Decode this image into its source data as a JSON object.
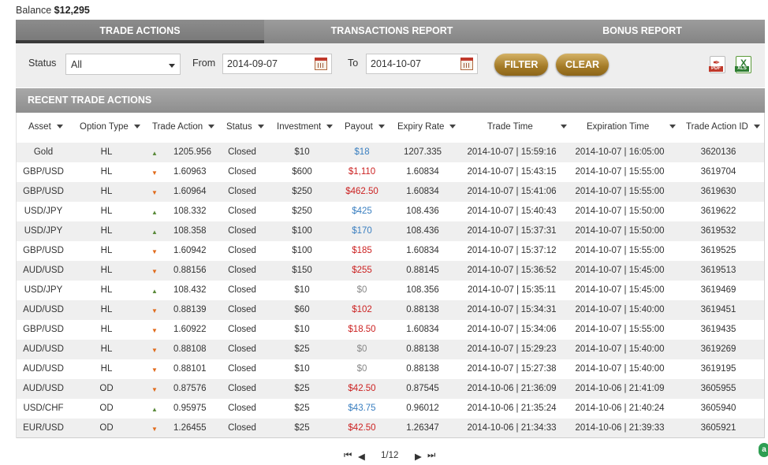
{
  "balance": {
    "label": "Balance",
    "value": "$12,295"
  },
  "tabs": [
    {
      "label": "TRADE ACTIONS"
    },
    {
      "label": "TRANSACTIONS REPORT"
    },
    {
      "label": "BONUS REPORT"
    }
  ],
  "filter": {
    "status_label": "Status",
    "status_value": "All",
    "from_label": "From",
    "from_value": "2014-09-07",
    "to_label": "To",
    "to_value": "2014-10-07",
    "filter_button": "FILTER",
    "clear_button": "CLEAR",
    "pdf_icon": "pdf-export-icon",
    "pdf_tag": "PDF",
    "xls_icon": "xls-export-icon",
    "xls_tag": "XLS"
  },
  "section_title": "RECENT TRADE ACTIONS",
  "columns": [
    "Asset",
    "Option Type",
    "Trade Action",
    "Status",
    "Investment",
    "Payout",
    "Expiry Rate",
    "Trade Time",
    "Expiration Time",
    "Trade Action ID"
  ],
  "rows": [
    {
      "asset": "Gold",
      "type": "HL",
      "dir": "up",
      "action": "1205.956",
      "status": "Closed",
      "investment": "$10",
      "payout": "$18",
      "payout_kind": "win",
      "expiry": "1207.335",
      "trade_time": "2014-10-07 | 15:59:16",
      "exp_time": "2014-10-07 | 16:05:00",
      "id": "3620136"
    },
    {
      "asset": "GBP/USD",
      "type": "HL",
      "dir": "down",
      "action": "1.60963",
      "status": "Closed",
      "investment": "$600",
      "payout": "$1,110",
      "payout_kind": "loss",
      "expiry": "1.60834",
      "trade_time": "2014-10-07 | 15:43:15",
      "exp_time": "2014-10-07 | 15:55:00",
      "id": "3619704"
    },
    {
      "asset": "GBP/USD",
      "type": "HL",
      "dir": "down",
      "action": "1.60964",
      "status": "Closed",
      "investment": "$250",
      "payout": "$462.50",
      "payout_kind": "loss",
      "expiry": "1.60834",
      "trade_time": "2014-10-07 | 15:41:06",
      "exp_time": "2014-10-07 | 15:55:00",
      "id": "3619630"
    },
    {
      "asset": "USD/JPY",
      "type": "HL",
      "dir": "up",
      "action": "108.332",
      "status": "Closed",
      "investment": "$250",
      "payout": "$425",
      "payout_kind": "win",
      "expiry": "108.436",
      "trade_time": "2014-10-07 | 15:40:43",
      "exp_time": "2014-10-07 | 15:50:00",
      "id": "3619622"
    },
    {
      "asset": "USD/JPY",
      "type": "HL",
      "dir": "up",
      "action": "108.358",
      "status": "Closed",
      "investment": "$100",
      "payout": "$170",
      "payout_kind": "win",
      "expiry": "108.436",
      "trade_time": "2014-10-07 | 15:37:31",
      "exp_time": "2014-10-07 | 15:50:00",
      "id": "3619532"
    },
    {
      "asset": "GBP/USD",
      "type": "HL",
      "dir": "down",
      "action": "1.60942",
      "status": "Closed",
      "investment": "$100",
      "payout": "$185",
      "payout_kind": "loss",
      "expiry": "1.60834",
      "trade_time": "2014-10-07 | 15:37:12",
      "exp_time": "2014-10-07 | 15:55:00",
      "id": "3619525"
    },
    {
      "asset": "AUD/USD",
      "type": "HL",
      "dir": "down",
      "action": "0.88156",
      "status": "Closed",
      "investment": "$150",
      "payout": "$255",
      "payout_kind": "loss",
      "expiry": "0.88145",
      "trade_time": "2014-10-07 | 15:36:52",
      "exp_time": "2014-10-07 | 15:45:00",
      "id": "3619513"
    },
    {
      "asset": "USD/JPY",
      "type": "HL",
      "dir": "up",
      "action": "108.432",
      "status": "Closed",
      "investment": "$10",
      "payout": "$0",
      "payout_kind": "zero",
      "expiry": "108.356",
      "trade_time": "2014-10-07 | 15:35:11",
      "exp_time": "2014-10-07 | 15:45:00",
      "id": "3619469"
    },
    {
      "asset": "AUD/USD",
      "type": "HL",
      "dir": "down",
      "action": "0.88139",
      "status": "Closed",
      "investment": "$60",
      "payout": "$102",
      "payout_kind": "loss",
      "expiry": "0.88138",
      "trade_time": "2014-10-07 | 15:34:31",
      "exp_time": "2014-10-07 | 15:40:00",
      "id": "3619451"
    },
    {
      "asset": "GBP/USD",
      "type": "HL",
      "dir": "down",
      "action": "1.60922",
      "status": "Closed",
      "investment": "$10",
      "payout": "$18.50",
      "payout_kind": "loss",
      "expiry": "1.60834",
      "trade_time": "2014-10-07 | 15:34:06",
      "exp_time": "2014-10-07 | 15:55:00",
      "id": "3619435"
    },
    {
      "asset": "AUD/USD",
      "type": "HL",
      "dir": "down",
      "action": "0.88108",
      "status": "Closed",
      "investment": "$25",
      "payout": "$0",
      "payout_kind": "zero",
      "expiry": "0.88138",
      "trade_time": "2014-10-07 | 15:29:23",
      "exp_time": "2014-10-07 | 15:40:00",
      "id": "3619269"
    },
    {
      "asset": "AUD/USD",
      "type": "HL",
      "dir": "down",
      "action": "0.88101",
      "status": "Closed",
      "investment": "$10",
      "payout": "$0",
      "payout_kind": "zero",
      "expiry": "0.88138",
      "trade_time": "2014-10-07 | 15:27:38",
      "exp_time": "2014-10-07 | 15:40:00",
      "id": "3619195"
    },
    {
      "asset": "AUD/USD",
      "type": "OD",
      "dir": "down",
      "action": "0.87576",
      "status": "Closed",
      "investment": "$25",
      "payout": "$42.50",
      "payout_kind": "loss",
      "expiry": "0.87545",
      "trade_time": "2014-10-06 | 21:36:09",
      "exp_time": "2014-10-06 | 21:41:09",
      "id": "3605955"
    },
    {
      "asset": "USD/CHF",
      "type": "OD",
      "dir": "up",
      "action": "0.95975",
      "status": "Closed",
      "investment": "$25",
      "payout": "$43.75",
      "payout_kind": "win",
      "expiry": "0.96012",
      "trade_time": "2014-10-06 | 21:35:24",
      "exp_time": "2014-10-06 | 21:40:24",
      "id": "3605940"
    },
    {
      "asset": "EUR/USD",
      "type": "OD",
      "dir": "down",
      "action": "1.26455",
      "status": "Closed",
      "investment": "$25",
      "payout": "$42.50",
      "payout_kind": "loss",
      "expiry": "1.26347",
      "trade_time": "2014-10-06 | 21:34:33",
      "exp_time": "2014-10-06 | 21:39:33",
      "id": "3605921"
    }
  ],
  "pager": {
    "page": "1/12"
  },
  "colors": {
    "win": "#3a7fc0",
    "loss": "#cc2222",
    "up_arrow": "#5a8a3a",
    "down_arrow": "#e06a1a",
    "gold_button": "#a37a26"
  }
}
